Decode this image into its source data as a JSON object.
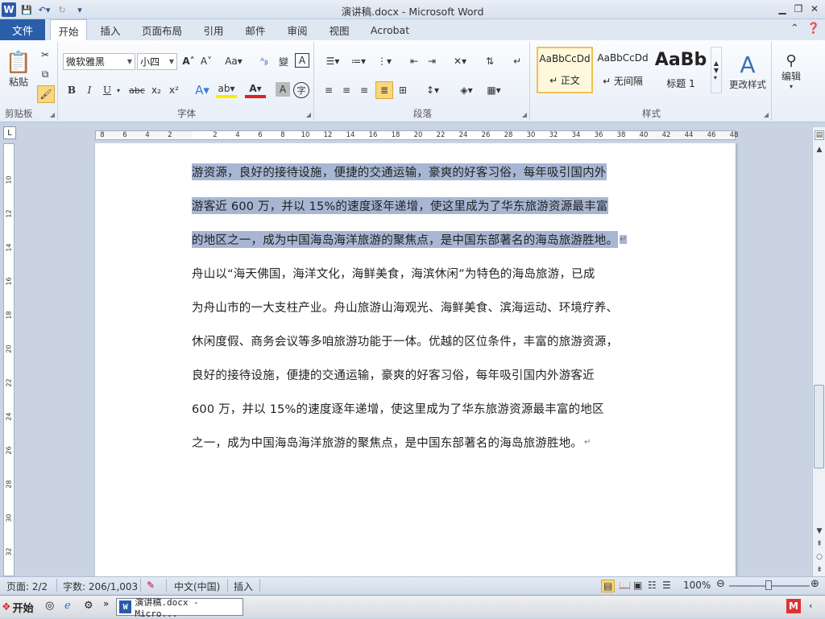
{
  "window": {
    "title": "演讲稿.docx - Microsoft Word"
  },
  "tabs": {
    "file": "文件",
    "items": [
      "开始",
      "插入",
      "页面布局",
      "引用",
      "邮件",
      "审阅",
      "视图",
      "Acrobat"
    ],
    "active": "开始"
  },
  "ribbon": {
    "clipboard": {
      "label": "剪贴板",
      "paste": "粘贴"
    },
    "font": {
      "label": "字体",
      "name": "微软雅黑",
      "size": "小四",
      "bold": "B",
      "italic": "I",
      "underline": "U",
      "strike": "abc",
      "sub": "x₂",
      "sup": "x²"
    },
    "paragraph": {
      "label": "段落"
    },
    "styles": {
      "label": "样式",
      "items": [
        {
          "preview": "AaBbCcDd",
          "name": "↵ 正文"
        },
        {
          "preview": "AaBbCcDd",
          "name": "↵ 无间隔"
        },
        {
          "preview": "AaBb",
          "name": "标题 1"
        }
      ],
      "change": "更改样式"
    },
    "editing": {
      "label": "编辑"
    }
  },
  "ruler": {
    "ticks": [
      "8",
      "6",
      "4",
      "2",
      "",
      "2",
      "4",
      "6",
      "8",
      "10",
      "12",
      "14",
      "16",
      "18",
      "20",
      "22",
      "24",
      "26",
      "28",
      "30",
      "32",
      "34",
      "36",
      "38",
      "40",
      "42",
      "44",
      "46",
      "48"
    ]
  },
  "vruler": {
    "ticks": [
      "10",
      "12",
      "14",
      "16",
      "18",
      "20",
      "22",
      "24",
      "26",
      "28",
      "30",
      "32"
    ]
  },
  "document": {
    "lines": [
      {
        "text": "游资源，良好的接待设施，便捷的交通运输，豪爽的好客习俗，每年吸引国内外",
        "selected": true
      },
      {
        "text": "游客近 600 万，并以 15%的速度逐年递增，使这里成为了华东旅游资源最丰富",
        "selected": true
      },
      {
        "text": "的地区之一，成为中国海岛海洋旅游的聚焦点，是中国东部著名的海岛旅游胜地。",
        "selected": true
      },
      {
        "text": "舟山以“海天佛国，海洋文化，海鲜美食，海滨休闲”为特色的海岛旅游，已成",
        "selected": false
      },
      {
        "text": "为舟山市的一大支柱产业。舟山旅游山海观光、海鲜美食、滨海运动、环境疗养、",
        "selected": false
      },
      {
        "text": "休闲度假、商务会议等多咱旅游功能于一体。优越的区位条件，丰富的旅游资源，",
        "selected": false
      },
      {
        "text": "良好的接待设施，便捷的交通运输，豪爽的好客习俗，每年吸引国内外游客近",
        "selected": false
      },
      {
        "text": "600 万，并以 15%的速度逐年递增，使这里成为了华东旅游资源最丰富的地区",
        "selected": false
      },
      {
        "text": "之一，成为中国海岛海洋旅游的聚焦点，是中国东部著名的海岛旅游胜地。",
        "selected": false
      }
    ]
  },
  "status": {
    "page": "页面: 2/2",
    "words": "字数: 206/1,003",
    "lang": "中文(中国)",
    "mode": "插入",
    "zoom": "100%"
  },
  "taskbar": {
    "start": "开始",
    "word_task": "演讲稿.docx - Micro..."
  }
}
